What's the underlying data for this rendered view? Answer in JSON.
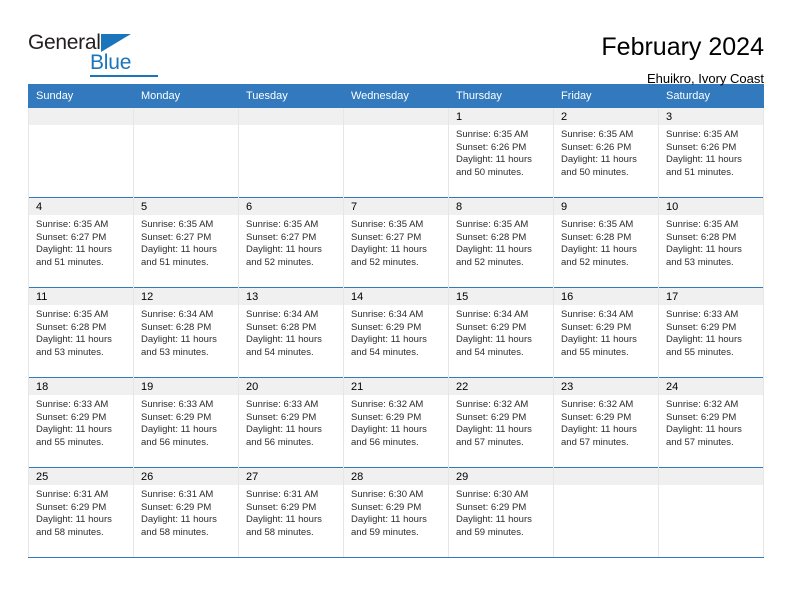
{
  "brand": {
    "name_part1": "General",
    "name_part2": "Blue",
    "accent_color": "#1b75bb"
  },
  "header": {
    "title": "February 2024",
    "subtitle": "Ehuikro, Ivory Coast"
  },
  "calendar": {
    "header_bg": "#3279bd",
    "daynum_bg": "#f0f0f0",
    "weekday_labels": [
      "Sunday",
      "Monday",
      "Tuesday",
      "Wednesday",
      "Thursday",
      "Friday",
      "Saturday"
    ],
    "weeks": [
      [
        {
          "day": "",
          "sunrise": "",
          "sunset": "",
          "daylight1": "",
          "daylight2": "",
          "empty": true
        },
        {
          "day": "",
          "sunrise": "",
          "sunset": "",
          "daylight1": "",
          "daylight2": "",
          "empty": true
        },
        {
          "day": "",
          "sunrise": "",
          "sunset": "",
          "daylight1": "",
          "daylight2": "",
          "empty": true
        },
        {
          "day": "",
          "sunrise": "",
          "sunset": "",
          "daylight1": "",
          "daylight2": "",
          "empty": true
        },
        {
          "day": "1",
          "sunrise": "Sunrise: 6:35 AM",
          "sunset": "Sunset: 6:26 PM",
          "daylight1": "Daylight: 11 hours",
          "daylight2": "and 50 minutes.",
          "empty": false
        },
        {
          "day": "2",
          "sunrise": "Sunrise: 6:35 AM",
          "sunset": "Sunset: 6:26 PM",
          "daylight1": "Daylight: 11 hours",
          "daylight2": "and 50 minutes.",
          "empty": false
        },
        {
          "day": "3",
          "sunrise": "Sunrise: 6:35 AM",
          "sunset": "Sunset: 6:26 PM",
          "daylight1": "Daylight: 11 hours",
          "daylight2": "and 51 minutes.",
          "empty": false
        }
      ],
      [
        {
          "day": "4",
          "sunrise": "Sunrise: 6:35 AM",
          "sunset": "Sunset: 6:27 PM",
          "daylight1": "Daylight: 11 hours",
          "daylight2": "and 51 minutes.",
          "empty": false
        },
        {
          "day": "5",
          "sunrise": "Sunrise: 6:35 AM",
          "sunset": "Sunset: 6:27 PM",
          "daylight1": "Daylight: 11 hours",
          "daylight2": "and 51 minutes.",
          "empty": false
        },
        {
          "day": "6",
          "sunrise": "Sunrise: 6:35 AM",
          "sunset": "Sunset: 6:27 PM",
          "daylight1": "Daylight: 11 hours",
          "daylight2": "and 52 minutes.",
          "empty": false
        },
        {
          "day": "7",
          "sunrise": "Sunrise: 6:35 AM",
          "sunset": "Sunset: 6:27 PM",
          "daylight1": "Daylight: 11 hours",
          "daylight2": "and 52 minutes.",
          "empty": false
        },
        {
          "day": "8",
          "sunrise": "Sunrise: 6:35 AM",
          "sunset": "Sunset: 6:28 PM",
          "daylight1": "Daylight: 11 hours",
          "daylight2": "and 52 minutes.",
          "empty": false
        },
        {
          "day": "9",
          "sunrise": "Sunrise: 6:35 AM",
          "sunset": "Sunset: 6:28 PM",
          "daylight1": "Daylight: 11 hours",
          "daylight2": "and 52 minutes.",
          "empty": false
        },
        {
          "day": "10",
          "sunrise": "Sunrise: 6:35 AM",
          "sunset": "Sunset: 6:28 PM",
          "daylight1": "Daylight: 11 hours",
          "daylight2": "and 53 minutes.",
          "empty": false
        }
      ],
      [
        {
          "day": "11",
          "sunrise": "Sunrise: 6:35 AM",
          "sunset": "Sunset: 6:28 PM",
          "daylight1": "Daylight: 11 hours",
          "daylight2": "and 53 minutes.",
          "empty": false
        },
        {
          "day": "12",
          "sunrise": "Sunrise: 6:34 AM",
          "sunset": "Sunset: 6:28 PM",
          "daylight1": "Daylight: 11 hours",
          "daylight2": "and 53 minutes.",
          "empty": false
        },
        {
          "day": "13",
          "sunrise": "Sunrise: 6:34 AM",
          "sunset": "Sunset: 6:28 PM",
          "daylight1": "Daylight: 11 hours",
          "daylight2": "and 54 minutes.",
          "empty": false
        },
        {
          "day": "14",
          "sunrise": "Sunrise: 6:34 AM",
          "sunset": "Sunset: 6:29 PM",
          "daylight1": "Daylight: 11 hours",
          "daylight2": "and 54 minutes.",
          "empty": false
        },
        {
          "day": "15",
          "sunrise": "Sunrise: 6:34 AM",
          "sunset": "Sunset: 6:29 PM",
          "daylight1": "Daylight: 11 hours",
          "daylight2": "and 54 minutes.",
          "empty": false
        },
        {
          "day": "16",
          "sunrise": "Sunrise: 6:34 AM",
          "sunset": "Sunset: 6:29 PM",
          "daylight1": "Daylight: 11 hours",
          "daylight2": "and 55 minutes.",
          "empty": false
        },
        {
          "day": "17",
          "sunrise": "Sunrise: 6:33 AM",
          "sunset": "Sunset: 6:29 PM",
          "daylight1": "Daylight: 11 hours",
          "daylight2": "and 55 minutes.",
          "empty": false
        }
      ],
      [
        {
          "day": "18",
          "sunrise": "Sunrise: 6:33 AM",
          "sunset": "Sunset: 6:29 PM",
          "daylight1": "Daylight: 11 hours",
          "daylight2": "and 55 minutes.",
          "empty": false
        },
        {
          "day": "19",
          "sunrise": "Sunrise: 6:33 AM",
          "sunset": "Sunset: 6:29 PM",
          "daylight1": "Daylight: 11 hours",
          "daylight2": "and 56 minutes.",
          "empty": false
        },
        {
          "day": "20",
          "sunrise": "Sunrise: 6:33 AM",
          "sunset": "Sunset: 6:29 PM",
          "daylight1": "Daylight: 11 hours",
          "daylight2": "and 56 minutes.",
          "empty": false
        },
        {
          "day": "21",
          "sunrise": "Sunrise: 6:32 AM",
          "sunset": "Sunset: 6:29 PM",
          "daylight1": "Daylight: 11 hours",
          "daylight2": "and 56 minutes.",
          "empty": false
        },
        {
          "day": "22",
          "sunrise": "Sunrise: 6:32 AM",
          "sunset": "Sunset: 6:29 PM",
          "daylight1": "Daylight: 11 hours",
          "daylight2": "and 57 minutes.",
          "empty": false
        },
        {
          "day": "23",
          "sunrise": "Sunrise: 6:32 AM",
          "sunset": "Sunset: 6:29 PM",
          "daylight1": "Daylight: 11 hours",
          "daylight2": "and 57 minutes.",
          "empty": false
        },
        {
          "day": "24",
          "sunrise": "Sunrise: 6:32 AM",
          "sunset": "Sunset: 6:29 PM",
          "daylight1": "Daylight: 11 hours",
          "daylight2": "and 57 minutes.",
          "empty": false
        }
      ],
      [
        {
          "day": "25",
          "sunrise": "Sunrise: 6:31 AM",
          "sunset": "Sunset: 6:29 PM",
          "daylight1": "Daylight: 11 hours",
          "daylight2": "and 58 minutes.",
          "empty": false
        },
        {
          "day": "26",
          "sunrise": "Sunrise: 6:31 AM",
          "sunset": "Sunset: 6:29 PM",
          "daylight1": "Daylight: 11 hours",
          "daylight2": "and 58 minutes.",
          "empty": false
        },
        {
          "day": "27",
          "sunrise": "Sunrise: 6:31 AM",
          "sunset": "Sunset: 6:29 PM",
          "daylight1": "Daylight: 11 hours",
          "daylight2": "and 58 minutes.",
          "empty": false
        },
        {
          "day": "28",
          "sunrise": "Sunrise: 6:30 AM",
          "sunset": "Sunset: 6:29 PM",
          "daylight1": "Daylight: 11 hours",
          "daylight2": "and 59 minutes.",
          "empty": false
        },
        {
          "day": "29",
          "sunrise": "Sunrise: 6:30 AM",
          "sunset": "Sunset: 6:29 PM",
          "daylight1": "Daylight: 11 hours",
          "daylight2": "and 59 minutes.",
          "empty": false
        },
        {
          "day": "",
          "sunrise": "",
          "sunset": "",
          "daylight1": "",
          "daylight2": "",
          "empty": true
        },
        {
          "day": "",
          "sunrise": "",
          "sunset": "",
          "daylight1": "",
          "daylight2": "",
          "empty": true
        }
      ]
    ]
  }
}
